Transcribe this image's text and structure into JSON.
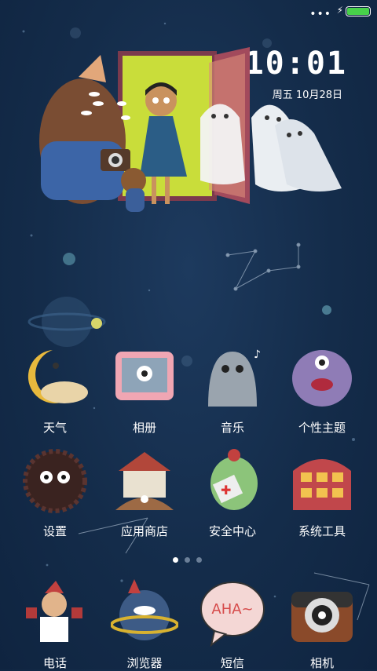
{
  "status_bar": {
    "battery_level": 1.0,
    "battery_color": "#47d14a"
  },
  "clock": {
    "time": "10:01",
    "date": "周五  10月28日"
  },
  "apps": [
    {
      "label": "天气",
      "icon": "moon-weather-icon"
    },
    {
      "label": "相册",
      "icon": "album-icon"
    },
    {
      "label": "音乐",
      "icon": "music-icon"
    },
    {
      "label": "个性主题",
      "icon": "theme-icon"
    },
    {
      "label": "设置",
      "icon": "settings-icon"
    },
    {
      "label": "应用商店",
      "icon": "app-store-icon"
    },
    {
      "label": "安全中心",
      "icon": "security-icon"
    },
    {
      "label": "系统工具",
      "icon": "system-tools-icon"
    }
  ],
  "dock": [
    {
      "label": "电话",
      "icon": "phone-icon"
    },
    {
      "label": "浏览器",
      "icon": "browser-icon"
    },
    {
      "label": "短信",
      "icon": "sms-icon",
      "bubble_text": "AHA~"
    },
    {
      "label": "相机",
      "icon": "camera-icon"
    }
  ],
  "pager": {
    "pages": 3,
    "current": 1
  }
}
